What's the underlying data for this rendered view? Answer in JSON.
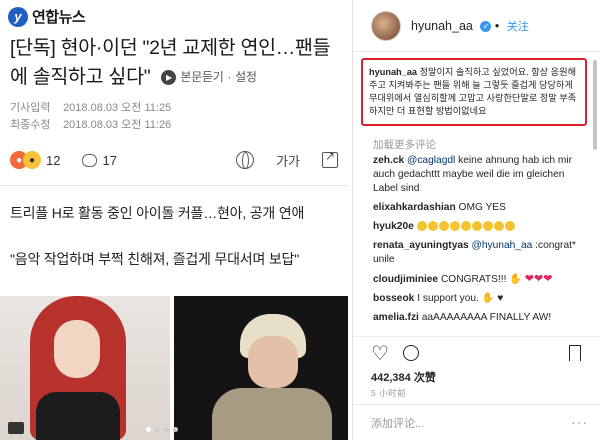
{
  "article": {
    "brand": "연합뉴스",
    "headline": "[단독] 현아·이던 \"2년 교제한 연인…팬들에 솔직하고 싶다\"",
    "listen_label": "본문듣기",
    "settings_label": "설정",
    "posted_label": "기사입력",
    "posted_value": "2018.08.03 오전 11:25",
    "edited_label": "최종수정",
    "edited_value": "2018.08.03 오전 11:26",
    "reaction_count": "12",
    "comment_count": "17",
    "font_label": "가가",
    "subheading": "트리플 H로 활동 중인 아이돌 커플…현아, 공개 연애",
    "quote": "\"음악 작업하며 부쩍 친해져, 즐겁게 무대서며 보답\""
  },
  "instagram": {
    "username": "hyunah_aa",
    "follow_label": "关注",
    "caption_user": "hyunah_aa",
    "caption_text": "정말이지 솔직하고 싶었어요. 항상 응원해주고 지켜봐주는 팬들 위해 늘 그렇듯 즐겁게 당당하게 무대위에서 열심히할께 고맙고 사랑한단말로 정말 부족하지만 더 표현할 방법이없네요",
    "load_more": "加载更多评论",
    "comments": [
      {
        "user": "zeh.ck",
        "mention": "@caglagdl",
        "text": "keine ahnung hab ich mir auch gedachttt maybe weil die im gleichen Label sind"
      },
      {
        "user": "elixahkardashian",
        "text": "OMG YES"
      },
      {
        "user": "hyuk20e",
        "text": ""
      },
      {
        "user": "renata_ayuningtyas",
        "mention": "@hyunah_aa",
        "text": ":congrat* unile"
      },
      {
        "user": "cloudjiminiee",
        "text": "CONGRATS!!!"
      },
      {
        "user": "bosseok",
        "text": "I support you."
      },
      {
        "user": "amelia.fzi",
        "text": "aaAAAAAAAA FINALLY AW!"
      }
    ],
    "views": "442,384 次赞",
    "time": "5 小时前",
    "add_comment_placeholder": "添加评论...",
    "more_menu": "···"
  }
}
